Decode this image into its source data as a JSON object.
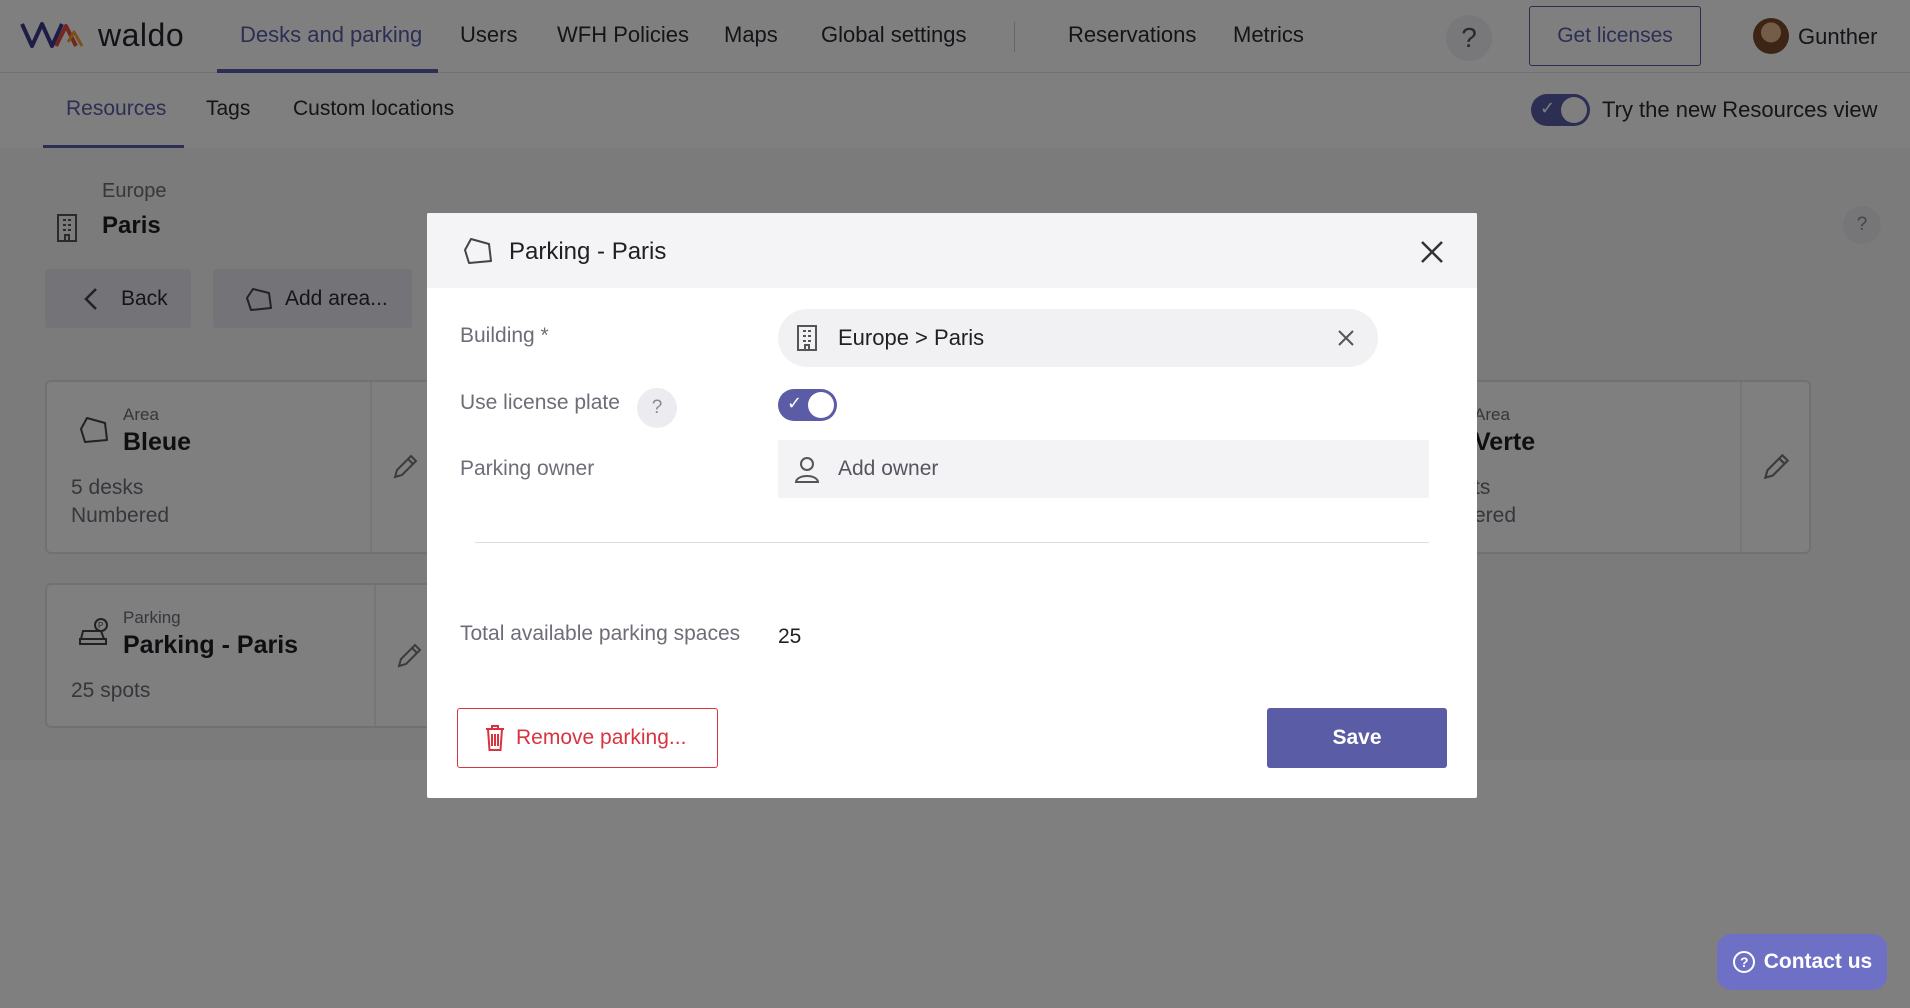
{
  "app": {
    "logo_text": "waldo"
  },
  "topnav": {
    "items": [
      "Desks and parking",
      "Users",
      "WFH Policies",
      "Maps",
      "Global settings",
      "Reservations",
      "Metrics"
    ],
    "help_label": "?",
    "get_licenses_label": "Get licenses",
    "user_name": "Gunther"
  },
  "subnav": {
    "tabs": [
      "Resources",
      "Tags",
      "Custom locations"
    ],
    "new_view_label": "Try the new Resources view",
    "new_view_on": true
  },
  "location": {
    "region": "Europe",
    "building": "Paris",
    "help_label": "?"
  },
  "actions": {
    "back_label": "Back",
    "add_area_label": "Add area..."
  },
  "cards": [
    {
      "kind": "Area",
      "name": "Bleue",
      "meta1": "5 desks",
      "meta2": "Numbered"
    },
    {
      "kind": "Area",
      "name": "Verte",
      "meta1": "ts",
      "meta2": "ered"
    },
    {
      "kind": "Parking",
      "name": "Parking - Paris",
      "meta1": "25 spots"
    }
  ],
  "contact": {
    "label": "Contact us"
  },
  "modal": {
    "title": "Parking - Paris",
    "building_label": "Building *",
    "building_value": "Europe > Paris",
    "license_plate_label": "Use license plate",
    "license_plate_help": "?",
    "license_plate_on": true,
    "owner_label": "Parking owner",
    "owner_placeholder": "Add owner",
    "total_label": "Total available parking spaces",
    "total_value": "25",
    "remove_label": "Remove parking...",
    "save_label": "Save"
  },
  "colors": {
    "accent": "#5b5ca6",
    "danger": "#d9333f",
    "contact": "#6e70c6"
  }
}
